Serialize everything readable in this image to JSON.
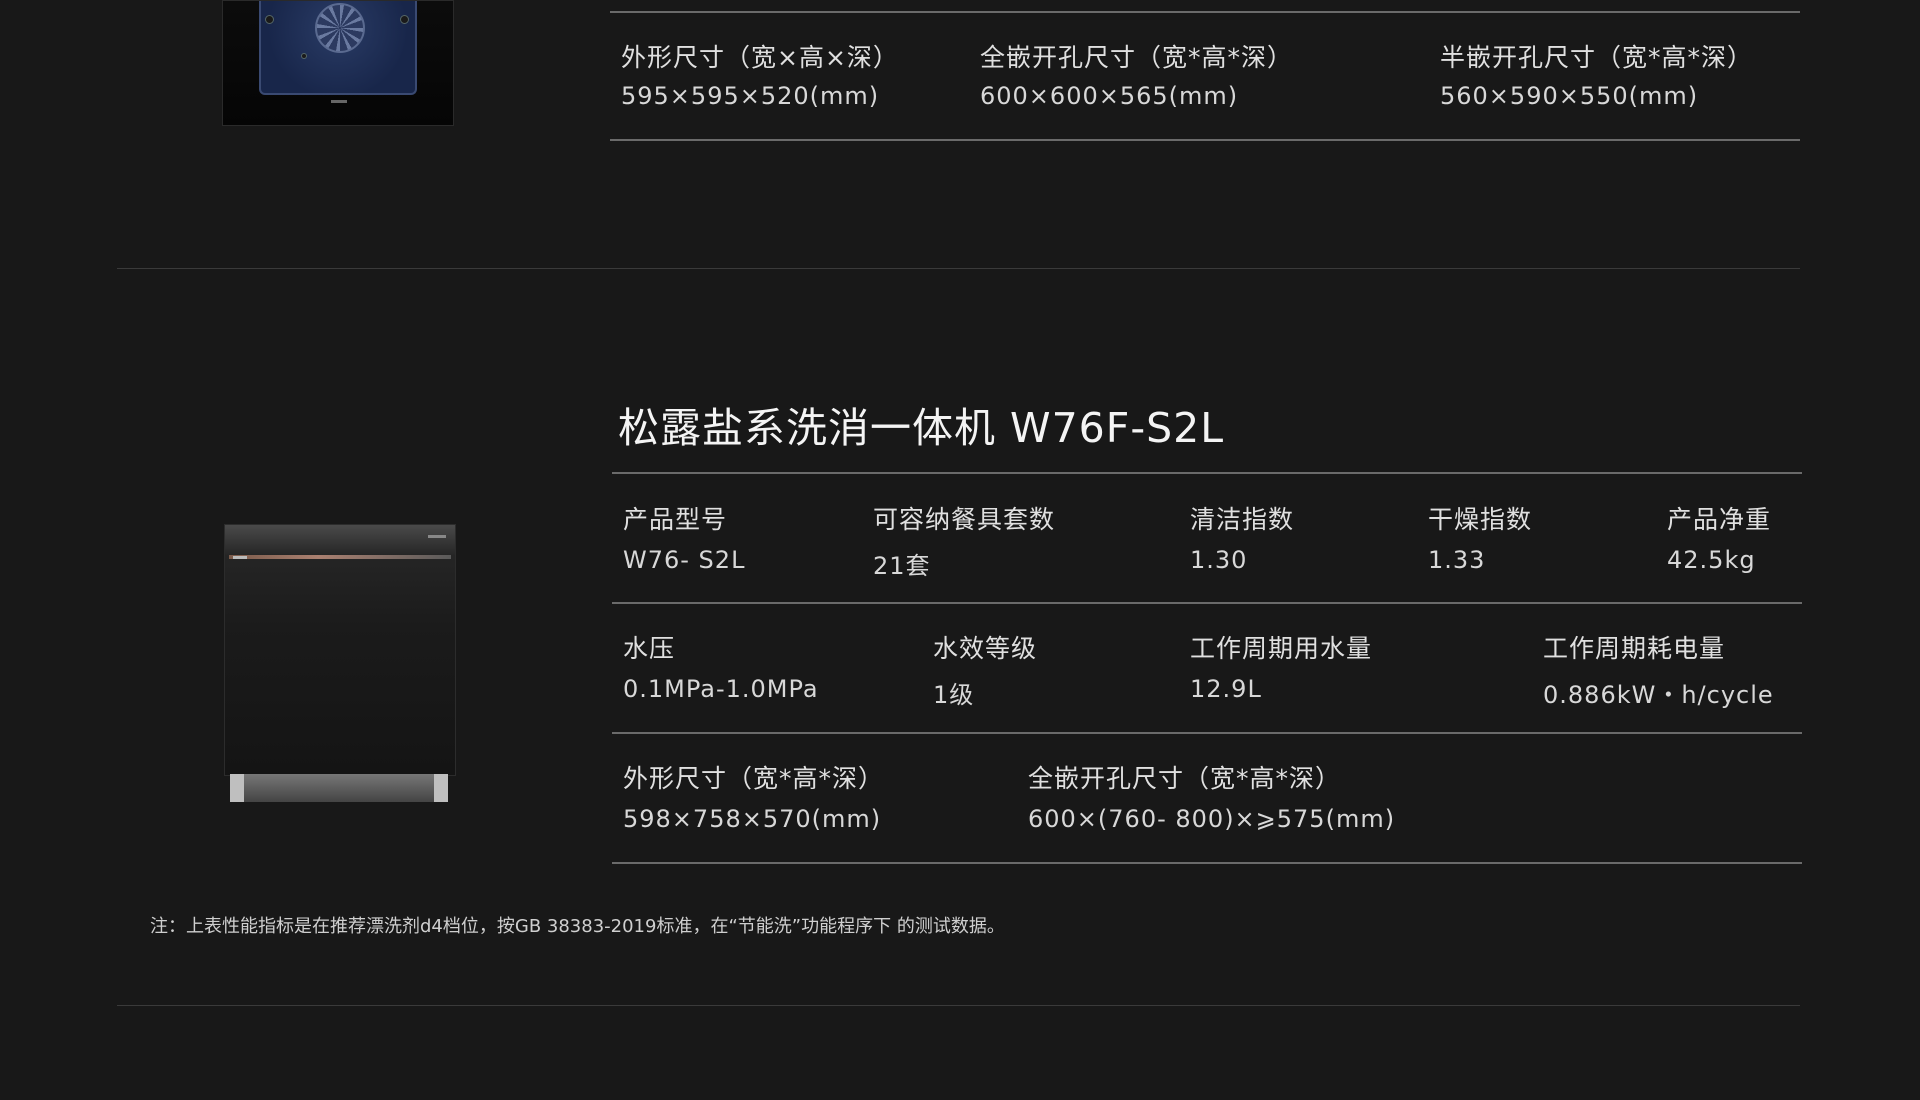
{
  "oven_section": {
    "specs": [
      {
        "label": "外形尺寸（宽×高×深）",
        "value": "595×595×520(mm)"
      },
      {
        "label": "全嵌开孔尺寸（宽*高*深）",
        "value": "600×600×565(mm)"
      },
      {
        "label": "半嵌开孔尺寸（宽*高*深）",
        "value": "560×590×550(mm)"
      }
    ]
  },
  "dishwasher": {
    "title": "松露盐系洗消一体机 W76F-S2L",
    "row1": [
      {
        "label": "产品型号",
        "value": "W76- S2L"
      },
      {
        "label": "可容纳餐具套数",
        "value": "21套"
      },
      {
        "label": "清洁指数",
        "value": "1.30"
      },
      {
        "label": "干燥指数",
        "value": "1.33"
      },
      {
        "label": "产品净重",
        "value": "42.5kg"
      }
    ],
    "row2": [
      {
        "label": "水压",
        "value": "0.1MPa-1.0MPa"
      },
      {
        "label": "水效等级",
        "value": "1级"
      },
      {
        "label": "工作周期用水量",
        "value": "12.9L"
      },
      {
        "label": "工作周期耗电量",
        "value": "0.886kW・h/cycle"
      }
    ],
    "row3": [
      {
        "label": "外形尺寸（宽*高*深）",
        "value": "598×758×570(mm)"
      },
      {
        "label": "全嵌开孔尺寸（宽*高*深）",
        "value": "600×(760- 800)×⩾575(mm)"
      }
    ],
    "note": "注：上表性能指标是在推荐漂洗剂d4档位，按GB 38383-2019标准，在“节能洗”功能程序下 的测试数据。"
  }
}
